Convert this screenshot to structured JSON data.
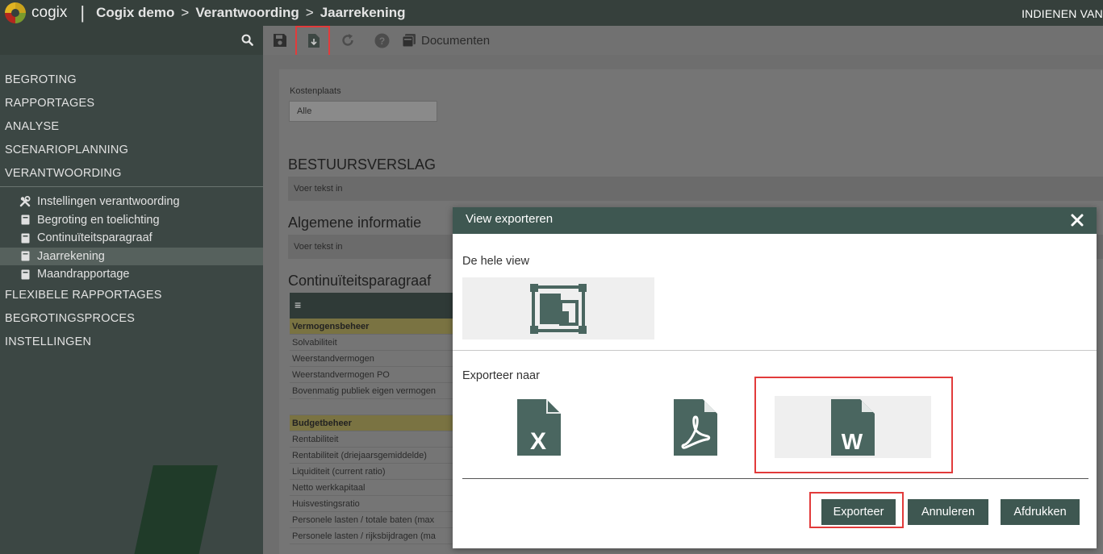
{
  "header": {
    "logo_text": "cogix",
    "separator": "|",
    "breadcrumb": [
      "Cogix demo",
      "Verantwoording",
      "Jaarrekening"
    ],
    "breadcrumb_arrow": ">",
    "right_label": "INDIENEN VAN"
  },
  "sidebar": {
    "items_top": [
      "BEGROTING",
      "RAPPORTAGES",
      "ANALYSE",
      "SCENARIOPLANNING",
      "VERANTWOORDING"
    ],
    "sub_items": [
      {
        "label": "Instellingen verantwoording",
        "icon": "tools-icon"
      },
      {
        "label": "Begroting en toelichting",
        "icon": "document-icon"
      },
      {
        "label": "Continuïteitsparagraaf",
        "icon": "document-icon"
      },
      {
        "label": "Jaarrekening",
        "icon": "document-icon",
        "active": true
      },
      {
        "label": "Maandrapportage",
        "icon": "document-icon"
      }
    ],
    "items_bottom": [
      "FLEXIBELE RAPPORTAGES",
      "BEGROTINGSPROCES",
      "INSTELLINGEN"
    ]
  },
  "toolbar": {
    "documents_label": "Documenten"
  },
  "main": {
    "kostenplaats_label": "Kostenplaats",
    "kostenplaats_value": "Alle",
    "section1_title": "BESTUURSVERSLAG",
    "section1_text": "Voer tekst in",
    "section2_title": "Algemene informatie",
    "section2_text": "Voer tekst in",
    "section3_title": "Continuïteitsparagraaf",
    "table_head_icon": "≡",
    "table_rows": [
      {
        "label": "Vermogensbeheer",
        "section": true
      },
      {
        "label": "Solvabiliteit"
      },
      {
        "label": "Weerstandvermogen"
      },
      {
        "label": "Weerstandvermogen PO"
      },
      {
        "label": "Bovenmatig publiek eigen vermogen"
      },
      {
        "label": "",
        "spacer": true
      },
      {
        "label": "Budgetbeheer",
        "section": true
      },
      {
        "label": "Rentabiliteit"
      },
      {
        "label": "Rentabiliteit (driejaarsgemiddelde)"
      },
      {
        "label": "Liquiditeit (current ratio)"
      },
      {
        "label": "Netto werkkapitaal"
      },
      {
        "label": "Huisvestingsratio"
      },
      {
        "label": "Personele lasten / totale baten (max"
      },
      {
        "label": "Personele lasten / rijksbijdragen (ma"
      }
    ]
  },
  "modal": {
    "title": "View exporteren",
    "whole_view_label": "De hele view",
    "export_to_label": "Exporteer naar",
    "export_formats": [
      "excel-icon",
      "pdf-icon",
      "word-icon"
    ],
    "buttons": {
      "export": "Exporteer",
      "cancel": "Annuleren",
      "print": "Afdrukken"
    }
  },
  "colors": {
    "header_bg": "#36403c",
    "sidebar_bg": "#3c4744",
    "accent": "#3e5751",
    "highlight": "#e23b3b"
  }
}
